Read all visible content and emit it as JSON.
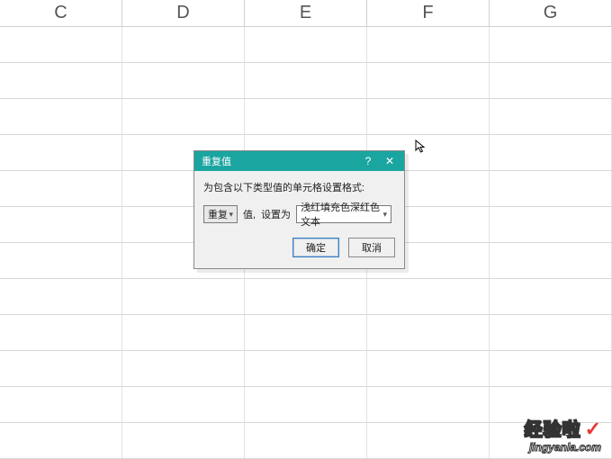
{
  "columns": [
    "C",
    "D",
    "E",
    "F",
    "G"
  ],
  "dialog": {
    "title": "重复值",
    "help_symbol": "?",
    "close_symbol": "✕",
    "instruction": "为包含以下类型值的单元格设置格式:",
    "duplicate_select": "重复",
    "value_label": "值,",
    "set_label": "设置为",
    "format_select": "浅红填充色深红色文本",
    "ok": "确定",
    "cancel": "取消"
  },
  "watermark": {
    "line1": "经验啦",
    "check": "✓",
    "line2": "jingyanla.com"
  }
}
